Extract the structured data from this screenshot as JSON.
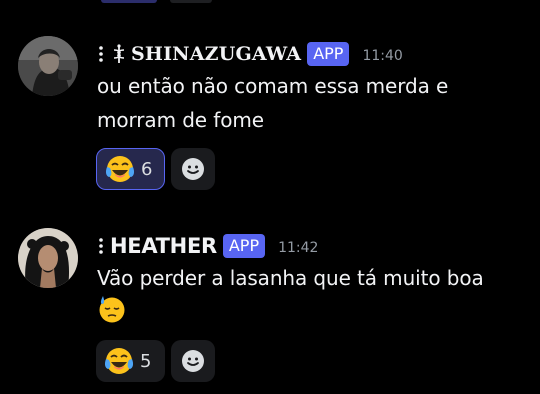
{
  "messages": [
    {
      "username": "SHINAZUGAWA",
      "name_symbol": "⚕",
      "badge": "APP",
      "timestamp": "11:40",
      "text_lines": [
        "ou então não comam essa merda e",
        "morram de fome"
      ],
      "reactions": [
        {
          "emoji": "face-with-tears-of-joy",
          "count": "6",
          "selected": true
        }
      ]
    },
    {
      "username": "HEATHER",
      "badge": "APP",
      "timestamp": "11:42",
      "text_lines": [
        "Vão perder a lasanha que tá muito boa"
      ],
      "inline_emoji": "downcast-face-with-sweat",
      "reactions": [
        {
          "emoji": "face-with-tears-of-joy",
          "count": "5",
          "selected": false
        }
      ]
    }
  ],
  "colors": {
    "background": "#000000",
    "accent": "#5865f2",
    "timestamp": "#949ba4",
    "text": "#f2f3f5"
  }
}
